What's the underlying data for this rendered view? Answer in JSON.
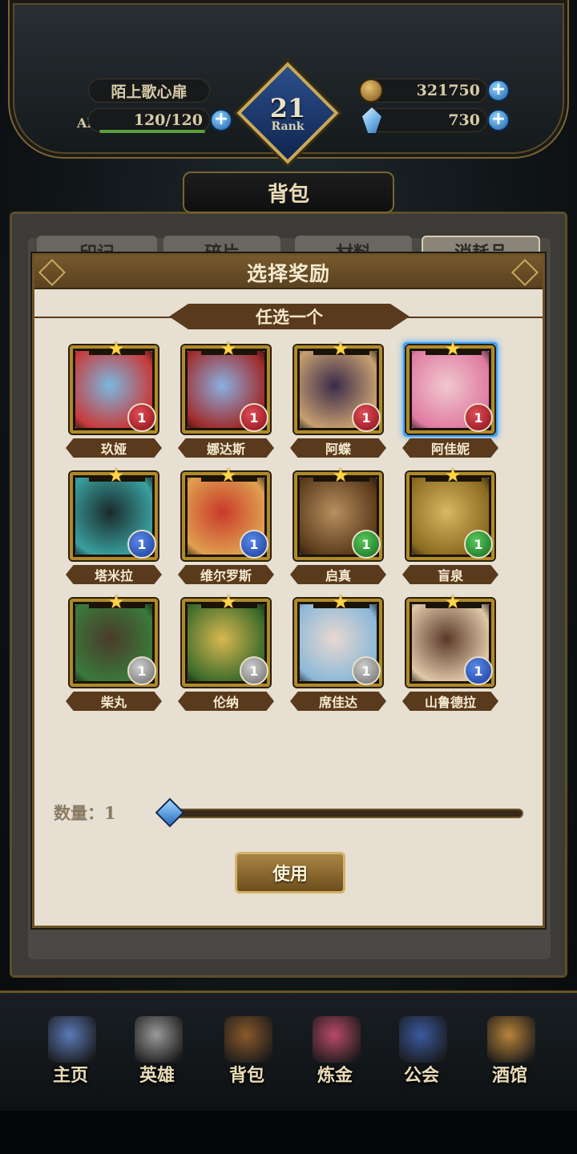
{
  "header": {
    "player_name": "陌上歌心扉",
    "ap_label": "AP",
    "ap_value": "120/120",
    "rank_number": "21",
    "rank_label": "Rank",
    "gold": "321750",
    "gems": "730",
    "plus_symbol": "+"
  },
  "screen_title": "背包",
  "bag_tabs": [
    "印记",
    "碎片",
    "材料",
    "消耗品"
  ],
  "dialog": {
    "title": "选择奖励",
    "subtitle": "任选一个",
    "heroes": [
      {
        "name": "玖娅",
        "element": "red",
        "level": "1",
        "selected": false
      },
      {
        "name": "娜达斯",
        "element": "red",
        "level": "1",
        "selected": false
      },
      {
        "name": "阿蝶",
        "element": "red",
        "level": "1",
        "selected": false
      },
      {
        "name": "阿佳妮",
        "element": "red",
        "level": "1",
        "selected": true
      },
      {
        "name": "塔米拉",
        "element": "blue",
        "level": "1",
        "selected": false
      },
      {
        "name": "维尔罗斯",
        "element": "blue",
        "level": "1",
        "selected": false
      },
      {
        "name": "启真",
        "element": "green",
        "level": "1",
        "selected": false
      },
      {
        "name": "盲泉",
        "element": "green",
        "level": "1",
        "selected": false
      },
      {
        "name": "柴丸",
        "element": "gray",
        "level": "1",
        "selected": false
      },
      {
        "name": "伦纳",
        "element": "gray",
        "level": "1",
        "selected": false
      },
      {
        "name": "席佳达",
        "element": "gray",
        "level": "1",
        "selected": false
      },
      {
        "name": "山鲁德拉",
        "element": "blue",
        "level": "1",
        "selected": false
      }
    ],
    "quantity_label": "数量：1",
    "quantity_value": 1,
    "use_button": "使用"
  },
  "nav": [
    {
      "label": "主页",
      "icon": "castle-icon",
      "color": "#5a7ab8"
    },
    {
      "label": "英雄",
      "icon": "helmet-icon",
      "color": "#9a9a9a"
    },
    {
      "label": "背包",
      "icon": "backpack-icon",
      "color": "#8a5a2a"
    },
    {
      "label": "炼金",
      "icon": "potion-icon",
      "color": "#b84a6a"
    },
    {
      "label": "公会",
      "icon": "shield-icon",
      "color": "#3a5aa0"
    },
    {
      "label": "酒馆",
      "icon": "beer-mug-icon",
      "color": "#b8843a"
    }
  ]
}
